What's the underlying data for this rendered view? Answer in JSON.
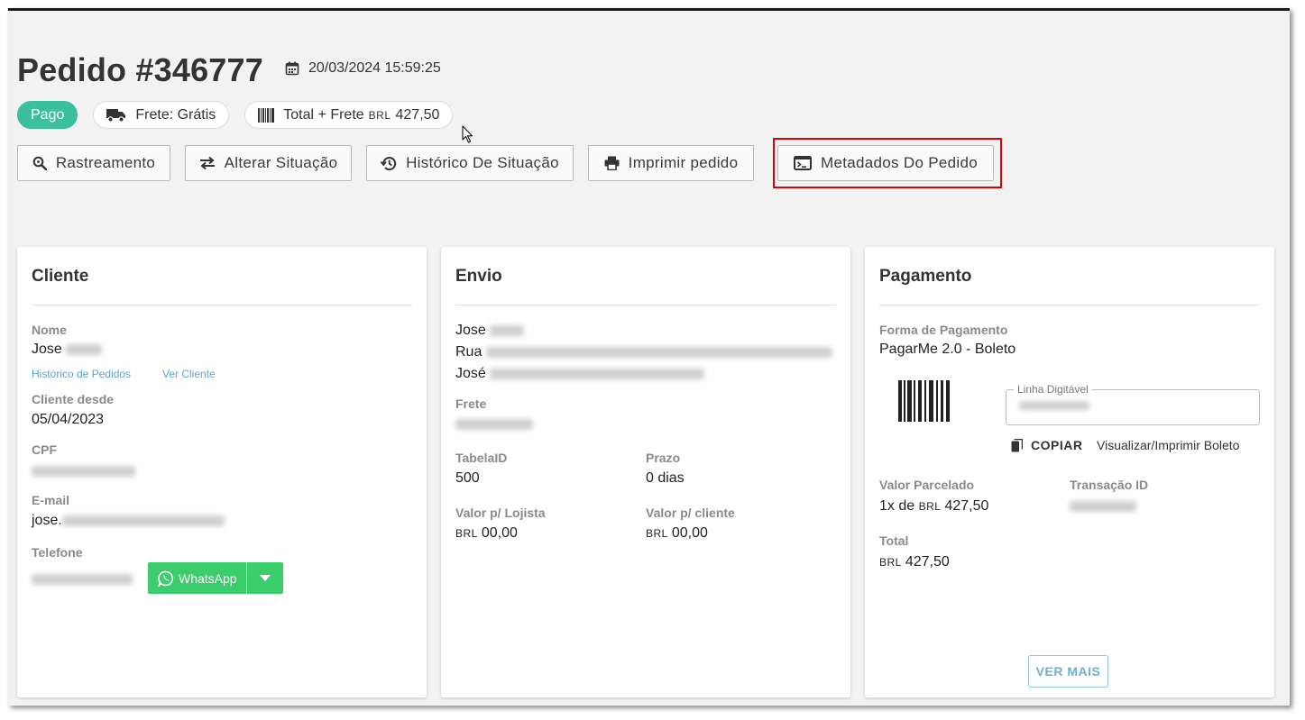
{
  "header": {
    "title": "Pedido #346777",
    "date": "20/03/2024 15:59:25",
    "date_icon": "calendar-icon"
  },
  "chips": {
    "status": "Pago",
    "shipping_label": "Frete: Grátis",
    "total_label": "Total + Frete",
    "total_currency": "BRL",
    "total_value": "427,50"
  },
  "actions": [
    {
      "label": "Rastreamento",
      "icon": "search-icon"
    },
    {
      "label": "Alterar Situação",
      "icon": "swap-arrows-icon"
    },
    {
      "label": "Histórico De Situação",
      "icon": "history-icon"
    },
    {
      "label": "Imprimir pedido",
      "icon": "printer-icon"
    },
    {
      "label": "Metadados Do Pedido",
      "icon": "terminal-icon"
    }
  ],
  "cliente": {
    "title": "Cliente",
    "nome_label": "Nome",
    "nome_value": "Jose",
    "historico_link": "Histórico de Pedidos",
    "ver_cliente_link": "Ver Cliente",
    "desde_label": "Cliente desde",
    "desde_value": "05/04/2023",
    "cpf_label": "CPF",
    "email_label": "E-mail",
    "email_value": "jose.",
    "telefone_label": "Telefone",
    "whatsapp_label": "WhatsApp"
  },
  "envio": {
    "title": "Envio",
    "line1": "Jose",
    "line2": "Rua",
    "line3": "José",
    "frete_label": "Frete",
    "tabela_label": "TabelaID",
    "tabela_value": "500",
    "prazo_label": "Prazo",
    "prazo_value": "0 dias",
    "lojista_label": "Valor p/ Lojista",
    "lojista_currency": "BRL",
    "lojista_value": "00,00",
    "cliente_label": "Valor p/ cliente",
    "cliente_currency": "BRL",
    "cliente_value": "00,00"
  },
  "pagamento": {
    "title": "Pagamento",
    "forma_label": "Forma de Pagamento",
    "forma_value": "PagarMe 2.0 - Boleto",
    "linha_label": "Linha Digitável",
    "copiar_label": "COPIAR",
    "visualizar_label": "Visualizar/Imprimir Boleto",
    "parcelado_label": "Valor Parcelado",
    "parcelado_prefix": "1x de",
    "parcelado_currency": "BRL",
    "parcelado_value": "427,50",
    "transacao_label": "Transação ID",
    "total_label": "Total",
    "total_currency": "BRL",
    "total_value": "427,50",
    "ver_mais_label": "VER MAIS"
  },
  "colors": {
    "status_paid": "#3bbf9f",
    "whatsapp": "#3bcc6b",
    "link": "#5aa6cf",
    "highlight": "#e00000"
  }
}
